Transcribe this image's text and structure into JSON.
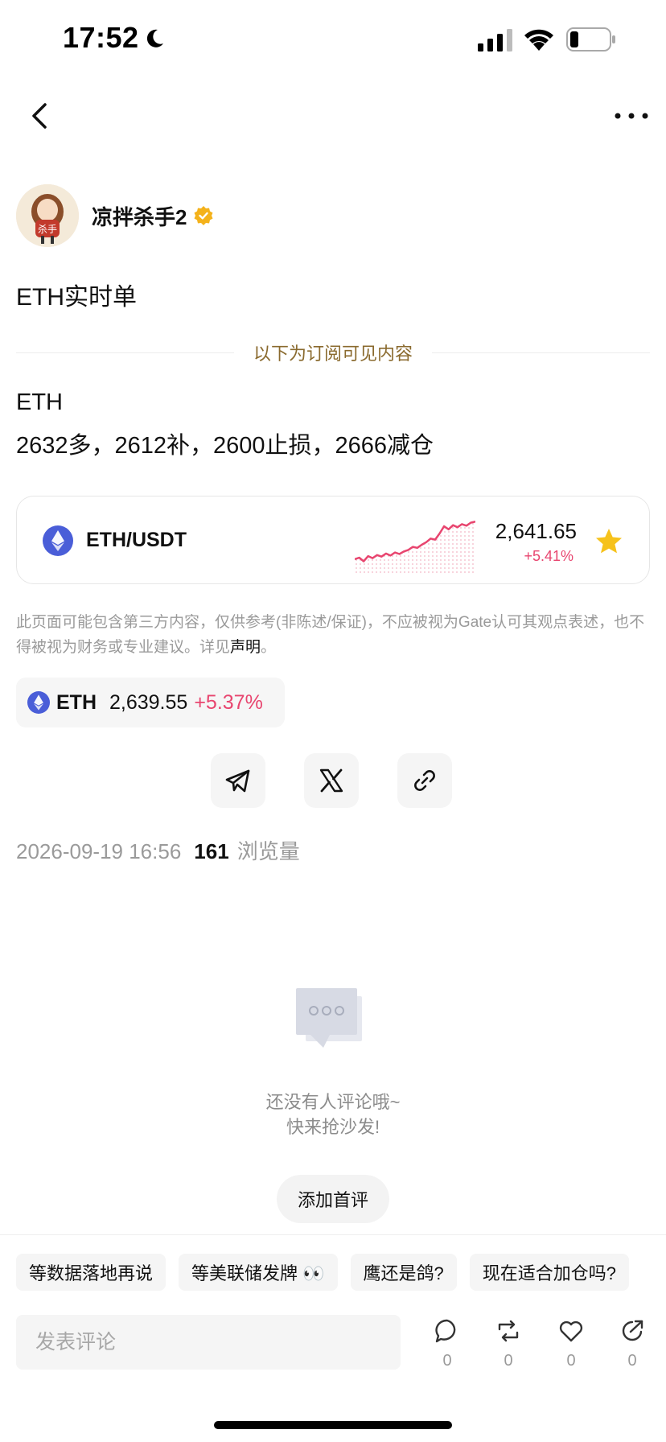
{
  "status_bar": {
    "time": "17:52"
  },
  "author": {
    "name": "凉拌杀手2",
    "avatar_text": "杀手"
  },
  "post": {
    "title": "ETH实时单",
    "subscriber_divider": "以下为订阅可见内容",
    "content_line1": "ETH",
    "content_line2": "2632多，2612补，2600止损，2666减仓"
  },
  "ticker_card": {
    "pair": "ETH/USDT",
    "price": "2,641.65",
    "change": "+5.41%",
    "favorited": true,
    "sparkline_values": [
      0.22,
      0.25,
      0.18,
      0.28,
      0.24,
      0.3,
      0.27,
      0.33,
      0.29,
      0.35,
      0.32,
      0.37,
      0.4,
      0.46,
      0.44,
      0.5,
      0.55,
      0.62,
      0.6,
      0.72,
      0.86,
      0.8,
      0.88,
      0.84,
      0.9,
      0.87,
      0.93,
      0.95
    ]
  },
  "disclaimer": {
    "text": "此页面可能包含第三方内容，仅供参考(非陈述/保证)，不应被视为Gate认可其观点表述，也不得被视为财务或专业建议。详见",
    "link": "声明",
    "end": "。"
  },
  "eth_chip": {
    "symbol": "ETH",
    "price": "2,639.55",
    "change": "+5.37%"
  },
  "meta": {
    "datetime": "2026-09-19 16:56",
    "views": "161",
    "views_label": "浏览量"
  },
  "empty_state": {
    "line1": "还没有人评论哦~",
    "line2": "快来抢沙发!",
    "button": "添加首评"
  },
  "quick_replies": [
    "等数据落地再说",
    "等美联储发牌 👀",
    "鹰还是鸽?",
    "现在适合加仓吗?"
  ],
  "comment": {
    "placeholder": "发表评论"
  },
  "actions": {
    "comments": "0",
    "reposts": "0",
    "likes": "0",
    "shares": "0"
  },
  "colors": {
    "up": "#e8456f",
    "eth_icon": "#4a5ed8",
    "star": "#f6c21c",
    "divider_text": "#8a6a2e"
  }
}
